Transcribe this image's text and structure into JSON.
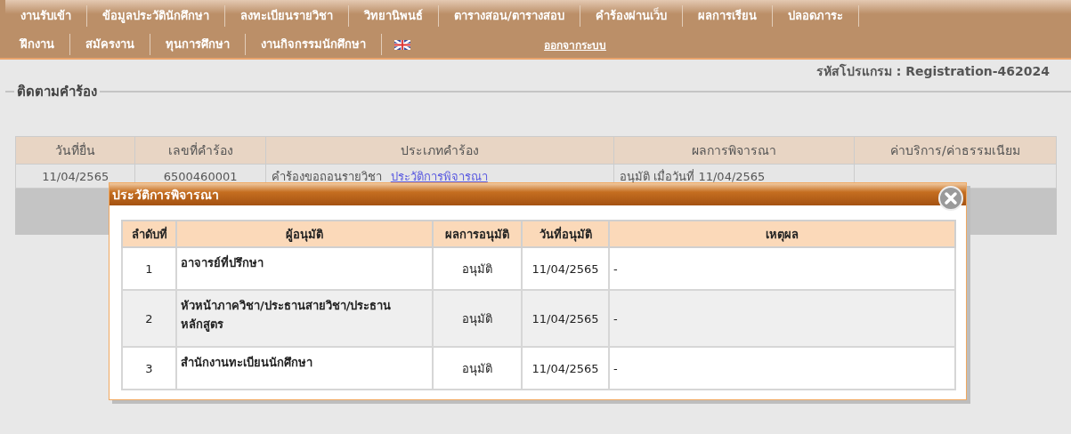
{
  "nav": {
    "row_1": [
      "งานรับเข้า",
      "ข้อมูลประวัตินักศึกษา",
      "ลงทะเบียนรายวิชา",
      "วิทยานิพนธ์",
      "ตารางสอน/ตารางสอบ",
      "คำร้องผ่านเว็บ",
      "ผลการเรียน",
      "ปลอดภาระ"
    ],
    "row_2": [
      "ฝึกงาน",
      "สมัครงาน",
      "ทุนการศึกษา",
      "งานกิจกรรมนักศึกษา"
    ],
    "logout": "ออกจากระบบ"
  },
  "program_code": "รหัสโปรแกรม : Registration-462024",
  "section_title": "ติดตามคำร้อง",
  "requests_table": {
    "columns": [
      "วันที่ยื่น",
      "เลขที่คำร้อง",
      "ประเภทคำร้อง",
      "ผลการพิจารณา",
      "ค่าบริการ/ค่าธรรมเนียม"
    ],
    "rows": [
      {
        "date": "11/04/2565",
        "number": "6500460001",
        "type": "คำร้องขอถอนรายวิชา",
        "history_link": "ประวัติการพิจารณา",
        "result": "อนุมัติ เมื่อวันที่ 11/04/2565"
      }
    ]
  },
  "dialog": {
    "title": "ประวัติการพิจารณา",
    "columns": [
      "ลำดับที่",
      "ผู้อนุมัติ",
      "ผลการอนุมัติ",
      "วันที่อนุมัติ",
      "เหตุผล"
    ],
    "rows": [
      {
        "order": "1",
        "approver": "อาจารย์ที่ปรึกษา",
        "result": "อนุมัติ",
        "date": "11/04/2565",
        "reason": "-"
      },
      {
        "order": "2",
        "approver": "หัวหน้าภาควิชา/ประธานสายวิชา/ประธานหลักสูตร",
        "result": "อนุมัติ",
        "date": "11/04/2565",
        "reason": "-"
      },
      {
        "order": "3",
        "approver": "สำนักงานทะเบียนนักศึกษา",
        "result": "อนุมัติ",
        "date": "11/04/2565",
        "reason": "-"
      }
    ]
  }
}
